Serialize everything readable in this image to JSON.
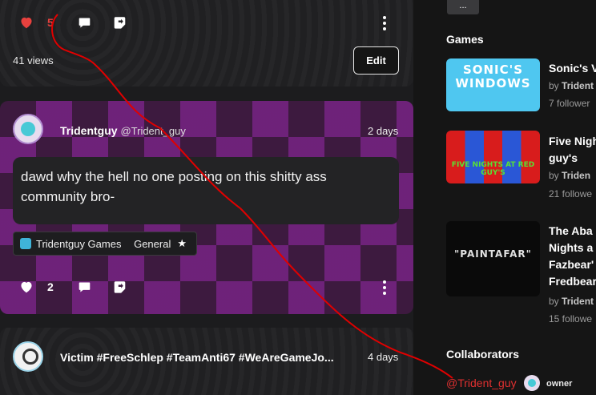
{
  "feed": {
    "post_top": {
      "likes": "5",
      "views": "41 views",
      "edit_label": "Edit"
    },
    "post_mid": {
      "author": "Tridentguy",
      "handle": "@Trident_guy",
      "time": "2 days",
      "body": "dawd why the hell no one posting on this shitty ass community bro-",
      "game_tag": "Tridentguy Games",
      "category_tag": "General",
      "likes": "2"
    },
    "post_bot": {
      "author": "Victim #FreeSchlep #TeamAnti67 #WeAreGameJo...",
      "time": "4 days"
    }
  },
  "side": {
    "more_label": "...",
    "games_title": "Games",
    "games": [
      {
        "thumb_text": "SONIC'S WINDOWS",
        "title_lines": [
          "Sonic's V"
        ],
        "by": "by",
        "owner": "Trident",
        "followers": "7 follower"
      },
      {
        "thumb_text": "FIVE NIGHTS AT RED GUY'S",
        "title_lines": [
          "Five Nigh",
          "guy's"
        ],
        "by": "by",
        "owner": "Triden",
        "followers": "21 followe"
      },
      {
        "thumb_text": "\"PAINTAFAR\"",
        "title_lines": [
          "The Aba",
          "Nights a",
          "Fazbear'",
          "Fredbear"
        ],
        "by": "by",
        "owner": "Trident",
        "followers": "15 followe"
      }
    ],
    "collab_title": "Collaborators",
    "collaborator": {
      "name": "@Trident_guy",
      "role": "owner"
    }
  },
  "colors": {
    "like_red": "#e8413e",
    "annotation_red": "#e00000",
    "bg": "#1c1c1e",
    "sidebar_bg": "#151515"
  }
}
